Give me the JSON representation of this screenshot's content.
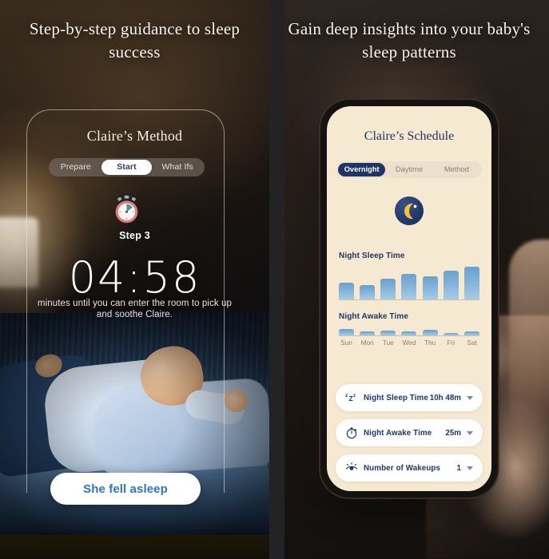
{
  "colors": {
    "accent_blue": "#2f74bd",
    "navy": "#1f3566",
    "cream": "#f6e9d2",
    "bar_blue": "#85b5d9",
    "white": "#ffffff"
  },
  "left": {
    "headline": "Step-by-step guidance to sleep success",
    "card": {
      "title": "Claire’s Method",
      "tabs": [
        {
          "label": "Prepare",
          "active": false
        },
        {
          "label": "Start",
          "active": true
        },
        {
          "label": "What Ifs",
          "active": false
        }
      ],
      "timer_icon": "stopwatch-icon",
      "step_label": "Step 3",
      "countdown": "04:58",
      "caption": "minutes until you can enter the room to pick up and soothe Claire.",
      "cta_label": "She fell asleep"
    }
  },
  "right": {
    "headline": "Gain deep insights into your baby's sleep patterns",
    "phone": {
      "title": "Claire’s Schedule",
      "tabs": [
        {
          "label": "Overnight",
          "active": true
        },
        {
          "label": "Daytime",
          "active": false
        },
        {
          "label": "Method",
          "active": false
        }
      ],
      "badge_icon": "crescent-moon-icon",
      "sections": [
        {
          "label": "Night Sleep Time"
        },
        {
          "label": "Night Awake Time"
        }
      ],
      "stats": [
        {
          "icon": "zzz-icon",
          "label": "Night Sleep Time",
          "value": "10h 48m"
        },
        {
          "icon": "stopwatch-icon",
          "label": "Night Awake Time",
          "value": "25m"
        },
        {
          "icon": "eye-open-icon",
          "label": "Number of Wakeups",
          "value": "1"
        }
      ]
    }
  },
  "chart_data": [
    {
      "type": "bar",
      "title": "Night Sleep Time",
      "categories": [
        "Sun",
        "Mon",
        "Tue",
        "Wed",
        "Thu",
        "Fri",
        "Sat"
      ],
      "values": [
        22,
        18,
        27,
        33,
        30,
        37,
        42
      ],
      "xlabel": "",
      "ylabel": "",
      "ylim": [
        0,
        45
      ],
      "grid": false,
      "legend": "none"
    },
    {
      "type": "bar",
      "title": "Night Awake Time",
      "categories": [
        "Sun",
        "Mon",
        "Tue",
        "Wed",
        "Thu",
        "Fri",
        "Sat"
      ],
      "values": [
        9,
        5,
        6,
        5,
        8,
        3,
        5
      ],
      "xlabel": "",
      "ylabel": "",
      "ylim": [
        0,
        14
      ],
      "grid": false,
      "legend": "none"
    }
  ]
}
